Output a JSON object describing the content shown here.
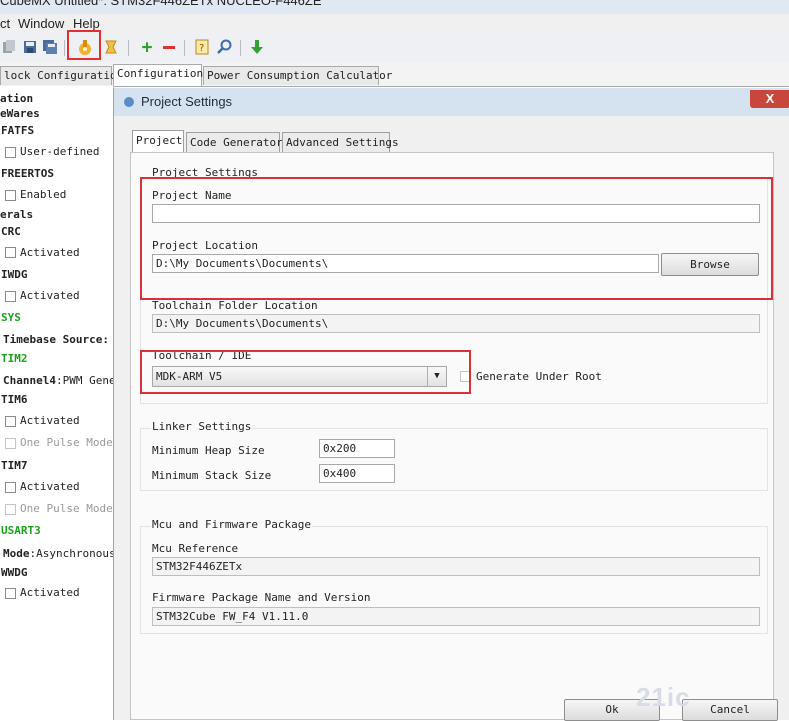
{
  "window": {
    "title": "CubeMX Untitled*: STM32F446ZETx NUCLEO-F446ZE"
  },
  "menu": {
    "items": [
      "ct",
      "Window",
      "Help"
    ]
  },
  "toolbar": {
    "icons": [
      "copy-icon",
      "save-icon",
      "save-as-icon",
      "generate-code-icon",
      "report-icon",
      "add-icon",
      "remove-icon",
      "help-icon",
      "search-icon",
      "download-icon"
    ]
  },
  "main_tabs": [
    {
      "label": "lock Configuration"
    },
    {
      "label": "Configuration"
    },
    {
      "label": "Power Consumption Calculator"
    }
  ],
  "left_panel": {
    "items": [
      {
        "text": "ation"
      },
      {
        "text": "eWares"
      },
      {
        "text": "FATFS"
      },
      {
        "text": "User-defined"
      },
      {
        "text": "FREERTOS"
      },
      {
        "text": "Enabled"
      },
      {
        "text": "erals"
      },
      {
        "text": "CRC"
      },
      {
        "text": "Activated"
      },
      {
        "text": "IWDG"
      },
      {
        "text": "Activated"
      },
      {
        "text": "SYS"
      },
      {
        "text": "Timebase Source"
      },
      {
        "text": "TIM2"
      },
      {
        "text": "Channel4"
      },
      {
        "text": "PWM Gene"
      },
      {
        "text": "TIM6"
      },
      {
        "text": "Activated"
      },
      {
        "text": "One Pulse Mode"
      },
      {
        "text": "TIM7"
      },
      {
        "text": "Activated"
      },
      {
        "text": "One Pulse Mode"
      },
      {
        "text": "USART3"
      },
      {
        "text": "Mode"
      },
      {
        "text": "Asynchronous"
      },
      {
        "text": "WWDG"
      },
      {
        "text": "Activated"
      }
    ]
  },
  "dialog": {
    "title": "Project Settings",
    "close_label": "X",
    "tabs": [
      {
        "label": "Project"
      },
      {
        "label": "Code Generator"
      },
      {
        "label": "Advanced Settings"
      }
    ],
    "project_settings_label": "Project Settings",
    "project_name_label": "Project Name",
    "project_name_value": "",
    "project_location_label": "Project Location",
    "project_location_value": "D:\\My Documents\\Documents\\",
    "browse_label": "Browse",
    "toolchain_folder_label": "Toolchain Folder Location",
    "toolchain_folder_value": "D:\\My Documents\\Documents\\",
    "toolchain_label": "Toolchain / IDE",
    "toolchain_value": "MDK-ARM V5",
    "generate_under_root_label": "Generate Under Root",
    "linker_settings_label": "Linker Settings",
    "min_heap_label": "Minimum Heap Size",
    "min_heap_value": "0x200",
    "min_stack_label": "Minimum Stack Size",
    "min_stack_value": "0x400",
    "mcu_package_label": "Mcu and Firmware Package",
    "mcu_reference_label": "Mcu Reference",
    "mcu_reference_value": "STM32F446ZETx",
    "firmware_label": "Firmware Package Name and Version",
    "firmware_value": "STM32Cube FW_F4 V1.11.0",
    "ok_label": "Ok",
    "cancel_label": "Cancel"
  },
  "watermark": {
    "text": "21ic"
  },
  "colors": {
    "highlight": "#d9303a",
    "green": "#1aa31a",
    "title_bar": "#d5e3f1"
  }
}
